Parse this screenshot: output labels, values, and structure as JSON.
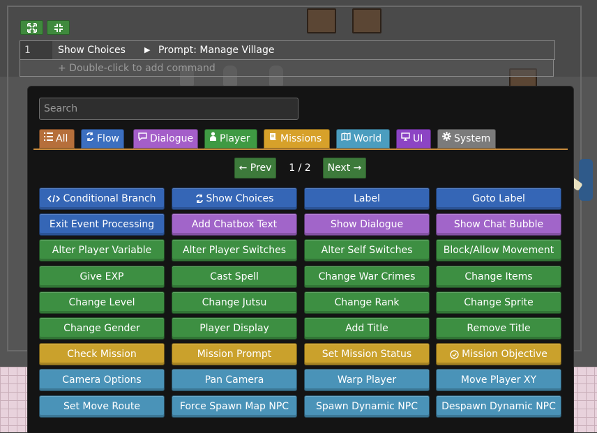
{
  "toolbar": {
    "expand_icon": "expand-icon",
    "collapse_icon": "collapse-icon"
  },
  "command_list": {
    "rows": [
      {
        "number": "1",
        "command": "Show Choices",
        "detail": "Prompt: Manage Village"
      }
    ],
    "add_hint": "+ Double-click to add command"
  },
  "palette": {
    "search_placeholder": "Search",
    "tabs": [
      {
        "label": "All",
        "icon": "list-icon",
        "color": "#b66f3b"
      },
      {
        "label": "Flow",
        "icon": "flow-icon",
        "color": "#3c6fc0"
      },
      {
        "label": "Dialogue",
        "icon": "speech-icon",
        "color": "#a45ec9"
      },
      {
        "label": "Player",
        "icon": "person-icon",
        "color": "#3f9a43"
      },
      {
        "label": "Missions",
        "icon": "scroll-icon",
        "color": "#d7a12a"
      },
      {
        "label": "World",
        "icon": "map-icon",
        "color": "#4b9dbf"
      },
      {
        "label": "UI",
        "icon": "monitor-icon",
        "color": "#8c44c4"
      },
      {
        "label": "System",
        "icon": "gear-icon",
        "color": "#7b7b7b"
      }
    ],
    "pager": {
      "prev_label": "← Prev",
      "next_label": "Next →",
      "page_text": "1 / 2"
    },
    "category_colors": {
      "flow": "#3566b6",
      "dialogue": "#a165c9",
      "player": "#3d8f42",
      "missions": "#caa12c",
      "world": "#4a93b8"
    },
    "commands": [
      {
        "label": "Conditional Branch",
        "cat": "flow",
        "icon": "code-icon"
      },
      {
        "label": "Show Choices",
        "cat": "flow",
        "icon": "flow-icon"
      },
      {
        "label": "Label",
        "cat": "flow"
      },
      {
        "label": "Goto Label",
        "cat": "flow"
      },
      {
        "label": "Exit Event Processing",
        "cat": "flow"
      },
      {
        "label": "Add Chatbox Text",
        "cat": "dialogue"
      },
      {
        "label": "Show Dialogue",
        "cat": "dialogue"
      },
      {
        "label": "Show Chat Bubble",
        "cat": "dialogue"
      },
      {
        "label": "Alter Player Variable",
        "cat": "player"
      },
      {
        "label": "Alter Player Switches",
        "cat": "player"
      },
      {
        "label": "Alter Self Switches",
        "cat": "player"
      },
      {
        "label": "Block/Allow Movement",
        "cat": "player"
      },
      {
        "label": "Give EXP",
        "cat": "player"
      },
      {
        "label": "Cast Spell",
        "cat": "player"
      },
      {
        "label": "Change War Crimes",
        "cat": "player"
      },
      {
        "label": "Change Items",
        "cat": "player"
      },
      {
        "label": "Change Level",
        "cat": "player"
      },
      {
        "label": "Change Jutsu",
        "cat": "player"
      },
      {
        "label": "Change Rank",
        "cat": "player"
      },
      {
        "label": "Change Sprite",
        "cat": "player"
      },
      {
        "label": "Change Gender",
        "cat": "player"
      },
      {
        "label": "Player Display",
        "cat": "player"
      },
      {
        "label": "Add Title",
        "cat": "player"
      },
      {
        "label": "Remove Title",
        "cat": "player"
      },
      {
        "label": "Check Mission",
        "cat": "missions"
      },
      {
        "label": "Mission Prompt",
        "cat": "missions"
      },
      {
        "label": "Set Mission Status",
        "cat": "missions"
      },
      {
        "label": "Mission Objective",
        "cat": "missions",
        "icon": "check-circle-icon"
      },
      {
        "label": "Camera Options",
        "cat": "world"
      },
      {
        "label": "Pan Camera",
        "cat": "world"
      },
      {
        "label": "Warp Player",
        "cat": "world"
      },
      {
        "label": "Move Player XY",
        "cat": "world"
      },
      {
        "label": "Set Move Route",
        "cat": "world"
      },
      {
        "label": "Force Spawn Map NPC",
        "cat": "world"
      },
      {
        "label": "Spawn Dynamic NPC",
        "cat": "world"
      },
      {
        "label": "Despawn Dynamic NPC",
        "cat": "world"
      }
    ]
  }
}
